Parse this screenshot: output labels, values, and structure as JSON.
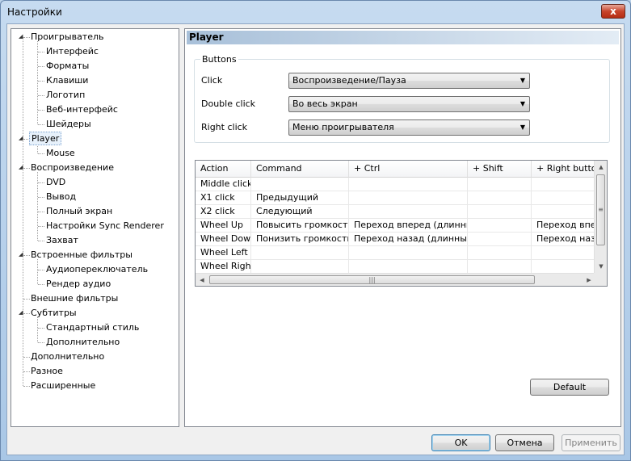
{
  "window": {
    "title": "Настройки",
    "close_glyph": "x"
  },
  "tree": {
    "items": [
      {
        "label": "Проигрыватель",
        "level": 0,
        "expanded": true
      },
      {
        "label": "Интерфейс",
        "level": 1
      },
      {
        "label": "Форматы",
        "level": 1
      },
      {
        "label": "Клавиши",
        "level": 1
      },
      {
        "label": "Логотип",
        "level": 1
      },
      {
        "label": "Веб-интерфейс",
        "level": 1
      },
      {
        "label": "Шейдеры",
        "level": 1
      },
      {
        "label": "Player",
        "level": 0,
        "expanded": true,
        "selected": true
      },
      {
        "label": "Mouse",
        "level": 1
      },
      {
        "label": "Воспроизведение",
        "level": 0,
        "expanded": true
      },
      {
        "label": "DVD",
        "level": 1
      },
      {
        "label": "Вывод",
        "level": 1
      },
      {
        "label": "Полный экран",
        "level": 1
      },
      {
        "label": "Настройки Sync Renderer",
        "level": 1
      },
      {
        "label": "Захват",
        "level": 1
      },
      {
        "label": "Встроенные фильтры",
        "level": 0,
        "expanded": true
      },
      {
        "label": "Аудиопереключатель",
        "level": 1
      },
      {
        "label": "Рендер аудио",
        "level": 1
      },
      {
        "label": "Внешние фильтры",
        "level": 0
      },
      {
        "label": "Субтитры",
        "level": 0,
        "expanded": true
      },
      {
        "label": "Стандартный стиль",
        "level": 1
      },
      {
        "label": "Дополнительно",
        "level": 1
      },
      {
        "label": "Дополнительно",
        "level": 0
      },
      {
        "label": "Разное",
        "level": 0
      },
      {
        "label": "Расширенные",
        "level": 0
      }
    ]
  },
  "panel": {
    "header": "Player",
    "buttons_group": {
      "title": "Buttons",
      "rows": [
        {
          "label": "Click",
          "value": "Воспроизведение/Пауза"
        },
        {
          "label": "Double click",
          "value": "Во весь экран"
        },
        {
          "label": "Right click",
          "value": "Меню проигрывателя"
        }
      ]
    },
    "grid": {
      "columns": [
        "Action",
        "Command",
        "+ Ctrl",
        "+ Shift",
        "+ Right button"
      ],
      "rows": [
        [
          "Middle click",
          "",
          "",
          "",
          ""
        ],
        [
          "X1 click",
          "Предыдущий",
          "",
          "",
          ""
        ],
        [
          "X2 click",
          "Следующий",
          "",
          "",
          ""
        ],
        [
          "Wheel Up",
          "Повысить громкость",
          "Переход вперед (длинный)",
          "",
          "Переход вперед"
        ],
        [
          "Wheel Down",
          "Понизить громкость",
          "Переход назад (длинный)",
          "",
          "Переход назад"
        ],
        [
          "Wheel Left",
          "",
          "",
          "",
          ""
        ],
        [
          "Wheel Right",
          "",
          "",
          "",
          ""
        ]
      ]
    },
    "default_button": "Default"
  },
  "footer": {
    "ok": "OK",
    "cancel": "Отмена",
    "apply": "Применить"
  }
}
